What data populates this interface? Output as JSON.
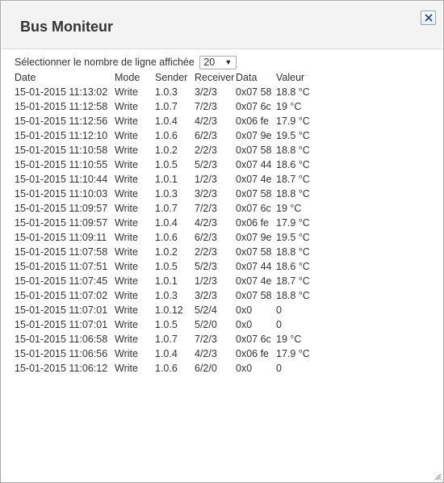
{
  "dialog": {
    "title": "Bus Moniteur",
    "close_icon": "close-icon"
  },
  "selector": {
    "label": "Sélectionner le nombre de ligne affichée",
    "value": "20"
  },
  "table": {
    "headers": {
      "date": "Date",
      "mode": "Mode",
      "sender": "Sender",
      "receiver": "Receiver",
      "data": "Data",
      "value": "Valeur"
    },
    "rows": [
      {
        "date": "15-01-2015 11:13:02",
        "mode": "Write",
        "sender": "1.0.3",
        "receiver": "3/2/3",
        "data": "0x07 58",
        "value": "18.8 °C"
      },
      {
        "date": "15-01-2015 11:12:58",
        "mode": "Write",
        "sender": "1.0.7",
        "receiver": "7/2/3",
        "data": "0x07 6c",
        "value": "19 °C"
      },
      {
        "date": "15-01-2015 11:12:56",
        "mode": "Write",
        "sender": "1.0.4",
        "receiver": "4/2/3",
        "data": "0x06 fe",
        "value": "17.9 °C"
      },
      {
        "date": "15-01-2015 11:12:10",
        "mode": "Write",
        "sender": "1.0.6",
        "receiver": "6/2/3",
        "data": "0x07 9e",
        "value": "19.5 °C"
      },
      {
        "date": "15-01-2015 11:10:58",
        "mode": "Write",
        "sender": "1.0.2",
        "receiver": "2/2/3",
        "data": "0x07 58",
        "value": "18.8 °C"
      },
      {
        "date": "15-01-2015 11:10:55",
        "mode": "Write",
        "sender": "1.0.5",
        "receiver": "5/2/3",
        "data": "0x07 44",
        "value": "18.6 °C"
      },
      {
        "date": "15-01-2015 11:10:44",
        "mode": "Write",
        "sender": "1.0.1",
        "receiver": "1/2/3",
        "data": "0x07 4e",
        "value": "18.7 °C"
      },
      {
        "date": "15-01-2015 11:10:03",
        "mode": "Write",
        "sender": "1.0.3",
        "receiver": "3/2/3",
        "data": "0x07 58",
        "value": "18.8 °C"
      },
      {
        "date": "15-01-2015 11:09:57",
        "mode": "Write",
        "sender": "1.0.7",
        "receiver": "7/2/3",
        "data": "0x07 6c",
        "value": "19 °C"
      },
      {
        "date": "15-01-2015 11:09:57",
        "mode": "Write",
        "sender": "1.0.4",
        "receiver": "4/2/3",
        "data": "0x06 fe",
        "value": "17.9 °C"
      },
      {
        "date": "15-01-2015 11:09:11",
        "mode": "Write",
        "sender": "1.0.6",
        "receiver": "6/2/3",
        "data": "0x07 9e",
        "value": "19.5 °C"
      },
      {
        "date": "15-01-2015 11:07:58",
        "mode": "Write",
        "sender": "1.0.2",
        "receiver": "2/2/3",
        "data": "0x07 58",
        "value": "18.8 °C"
      },
      {
        "date": "15-01-2015 11:07:51",
        "mode": "Write",
        "sender": "1.0.5",
        "receiver": "5/2/3",
        "data": "0x07 44",
        "value": "18.6 °C"
      },
      {
        "date": "15-01-2015 11:07:45",
        "mode": "Write",
        "sender": "1.0.1",
        "receiver": "1/2/3",
        "data": "0x07 4e",
        "value": "18.7 °C"
      },
      {
        "date": "15-01-2015 11:07:02",
        "mode": "Write",
        "sender": "1.0.3",
        "receiver": "3/2/3",
        "data": "0x07 58",
        "value": "18.8 °C"
      },
      {
        "date": "15-01-2015 11:07:01",
        "mode": "Write",
        "sender": "1.0.12",
        "receiver": "5/2/4",
        "data": "0x0",
        "value": "0"
      },
      {
        "date": "15-01-2015 11:07:01",
        "mode": "Write",
        "sender": "1.0.5",
        "receiver": "5/2/0",
        "data": "0x0",
        "value": "0"
      },
      {
        "date": "15-01-2015 11:06:58",
        "mode": "Write",
        "sender": "1.0.7",
        "receiver": "7/2/3",
        "data": "0x07 6c",
        "value": "19 °C"
      },
      {
        "date": "15-01-2015 11:06:56",
        "mode": "Write",
        "sender": "1.0.4",
        "receiver": "4/2/3",
        "data": "0x06 fe",
        "value": "17.9 °C"
      },
      {
        "date": "15-01-2015 11:06:12",
        "mode": "Write",
        "sender": "1.0.6",
        "receiver": "6/2/0",
        "data": "0x0",
        "value": "0"
      }
    ]
  },
  "colors": {
    "titlebar": "#f3f3f3",
    "text": "#333333",
    "border": "#a8a8a8"
  }
}
